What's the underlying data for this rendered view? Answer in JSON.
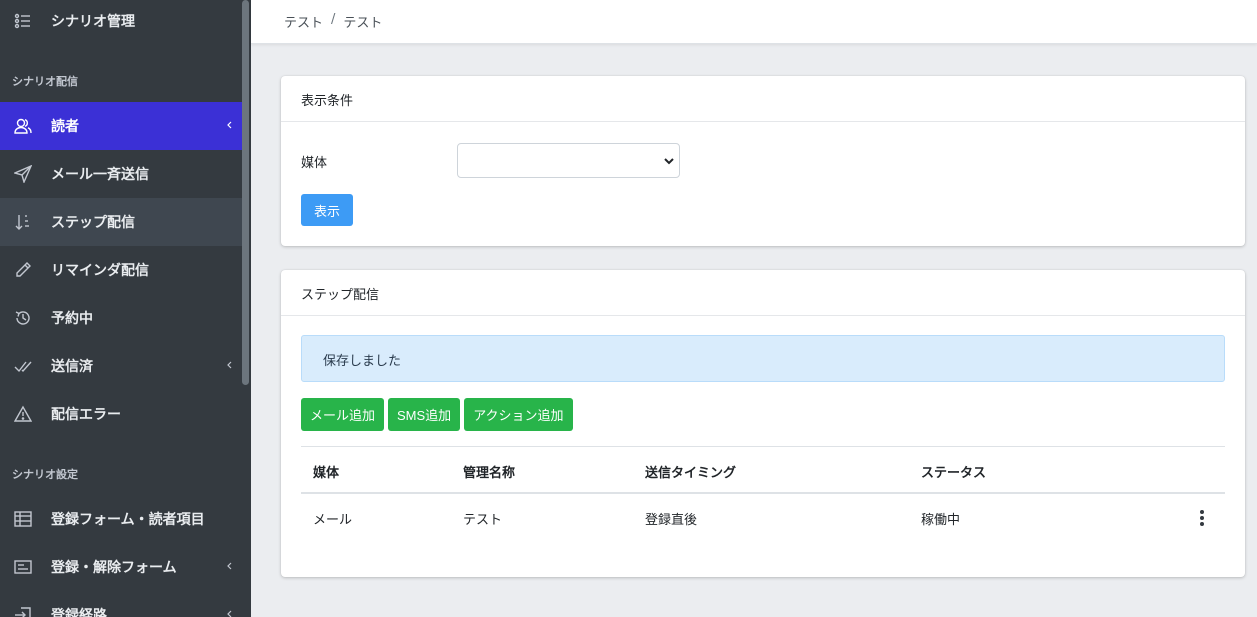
{
  "sidebar": {
    "top_item": "シナリオ管理",
    "section1_header": "シナリオ配信",
    "items": [
      {
        "label": "読者",
        "icon": "users-icon"
      },
      {
        "label": "メール一斉送信",
        "icon": "send-icon"
      },
      {
        "label": "ステップ配信",
        "icon": "sort-down-icon"
      },
      {
        "label": "リマインダ配信",
        "icon": "pencil-icon"
      },
      {
        "label": "予約中",
        "icon": "history-icon"
      },
      {
        "label": "送信済",
        "icon": "check-icon"
      },
      {
        "label": "配信エラー",
        "icon": "warning-icon"
      }
    ],
    "section2_header": "シナリオ設定",
    "items2": [
      {
        "label": "登録フォーム・読者項目",
        "icon": "table-icon"
      },
      {
        "label": "登録・解除フォーム",
        "icon": "form-icon"
      },
      {
        "label": "登録経路",
        "icon": "sign-in-icon"
      }
    ]
  },
  "breadcrumb": {
    "first": "テスト",
    "separator": "/",
    "second": "テスト"
  },
  "filter_card": {
    "title": "表示条件",
    "media_label": "媒体",
    "media_value": "",
    "show_button": "表示"
  },
  "step_card": {
    "title": "ステップ配信",
    "alert": "保存しました",
    "buttons": {
      "add_mail": "メール追加",
      "add_sms": "SMS追加",
      "add_action": "アクション追加"
    },
    "columns": {
      "media": "媒体",
      "name": "管理名称",
      "timing": "送信タイミング",
      "status": "ステータス"
    },
    "rows": [
      {
        "media": "メール",
        "name": "テスト",
        "timing": "登録直後",
        "status": "稼働中"
      }
    ]
  },
  "colors": {
    "sidebar_bg": "#343a40",
    "active": "#3b30d6",
    "primary": "#3d9bf5",
    "success": "#28b44a"
  }
}
